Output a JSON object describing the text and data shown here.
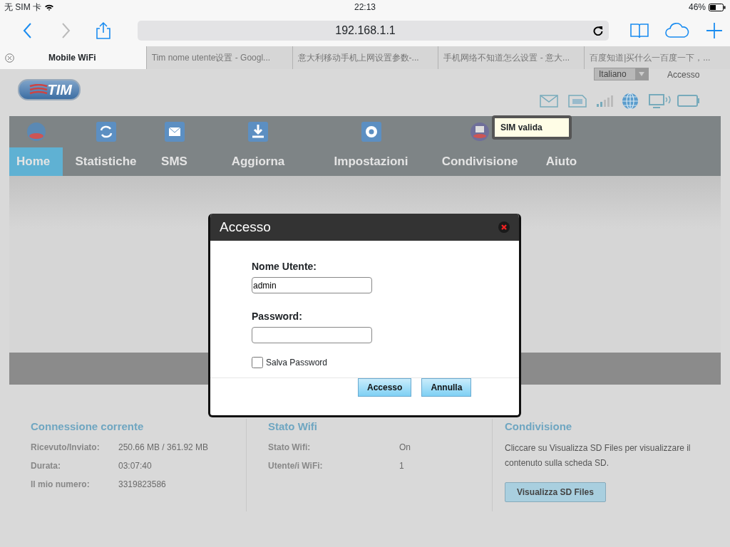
{
  "status_bar": {
    "carrier": "无 SIM 卡",
    "time": "22:13",
    "battery": "46%"
  },
  "browser": {
    "url": "192.168.1.1",
    "tabs": [
      {
        "title": "Mobile WiFi",
        "selected": true
      },
      {
        "title": "Tim nome utente设置 - Googl...",
        "selected": false
      },
      {
        "title": "意大利移动手机上网设置参数-...",
        "selected": false
      },
      {
        "title": "手机网络不知道怎么设置 - 意大...",
        "selected": false
      },
      {
        "title": "百度知道|买什么一百度一下，...",
        "selected": false
      }
    ]
  },
  "page": {
    "logo": "TIM",
    "language": "Italiano",
    "login_link": "Accesso",
    "tooltip": "SIM valida",
    "nav": [
      {
        "label": "Home",
        "selected": true
      },
      {
        "label": "Statistiche",
        "selected": false
      },
      {
        "label": "SMS",
        "selected": false
      },
      {
        "label": "Aggiorna",
        "selected": false
      },
      {
        "label": "Impostazioni",
        "selected": false
      },
      {
        "label": "Condivisione",
        "selected": false
      },
      {
        "label": "Aiuto",
        "selected": false
      }
    ],
    "sections": [
      {
        "title": "Connessione corrente",
        "rows": [
          {
            "label": "Ricevuto/Inviato:",
            "value": "250.66 MB /  361.92 MB"
          },
          {
            "label": "Durata:",
            "value": "03:07:40"
          },
          {
            "label": "Il mio numero:",
            "value": "3319823586"
          }
        ]
      },
      {
        "title": "Stato Wifi",
        "rows": [
          {
            "label": "Stato Wifi:",
            "value": "On"
          },
          {
            "label": "Utente/i WiFi:",
            "value": "1"
          }
        ]
      },
      {
        "title": "Condivisione",
        "text": "Cliccare su Visualizza SD Files per visualizzare il contenuto sulla scheda SD.",
        "button": "Visualizza SD Files"
      }
    ]
  },
  "dialog": {
    "title": "Accesso",
    "fields": [
      {
        "label": "Nome Utente:",
        "value": "admin"
      },
      {
        "label": "Password:"
      }
    ],
    "remember": {
      "label": "Salva Password",
      "checked": false
    },
    "buttons": [
      "Accesso",
      "Annulla"
    ]
  }
}
